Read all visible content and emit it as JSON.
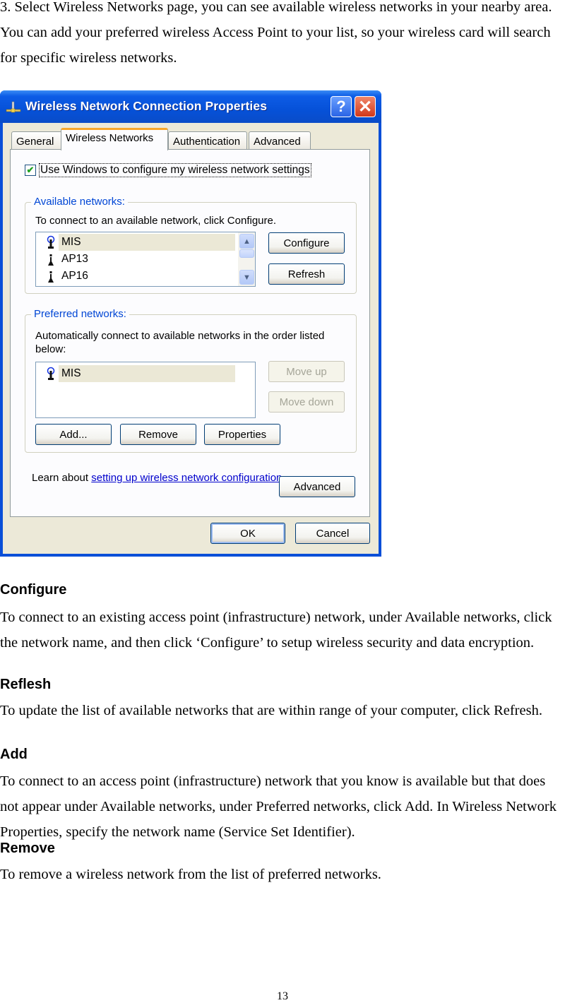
{
  "intro": "3. Select Wireless Networks page, you can see available wireless networks in your nearby area. You can add your preferred wireless Access Point to your list, so your wireless card will search for specific wireless networks.",
  "dialog": {
    "title": "Wireless Network Connection Properties",
    "help_label": "?",
    "close_label": "✕",
    "tabs": [
      {
        "label": "General"
      },
      {
        "label": "Wireless Networks",
        "active": true
      },
      {
        "label": "Authentication"
      },
      {
        "label": "Advanced"
      }
    ],
    "use_windows_checkbox": {
      "label": "Use Windows to configure my wireless network settings",
      "checked": true,
      "check_glyph": "✔"
    },
    "available": {
      "title": "Available networks:",
      "description": "To connect to an available network, click Configure.",
      "networks": [
        {
          "name": "MIS",
          "selected": true,
          "icon": "wireless-ap-configured-icon"
        },
        {
          "name": "AP13",
          "selected": false,
          "icon": "wireless-ap-icon"
        },
        {
          "name": "AP16",
          "selected": false,
          "icon": "wireless-ap-icon"
        }
      ],
      "configure_label": "Configure",
      "refresh_label": "Refresh",
      "scroll_up_glyph": "▲",
      "scroll_down_glyph": "▼"
    },
    "preferred": {
      "title": "Preferred networks:",
      "description": "Automatically connect to available networks in the order listed below:",
      "networks": [
        {
          "name": "MIS",
          "selected": true,
          "icon": "wireless-ap-configured-icon"
        }
      ],
      "move_up_label": "Move up",
      "move_down_label": "Move down",
      "add_label": "Add...",
      "remove_label": "Remove",
      "properties_label": "Properties"
    },
    "learn_prefix": "Learn about ",
    "learn_link": "setting up wireless network configuration.",
    "advanced_label": "Advanced",
    "ok_label": "OK",
    "cancel_label": "Cancel"
  },
  "sections": [
    {
      "heading": "Configure",
      "body": "To connect to an existing access point (infrastructure) network, under Available networks, click the network name, and then click ‘Configure’ to setup wireless security and data encryption."
    },
    {
      "heading": "Reflesh",
      "body": "To update the list of available networks that are within range of your computer, click Refresh."
    },
    {
      "heading": "Add",
      "body": "To connect to an access point (infrastructure) network that you know is available but that does not appear under Available networks, under Preferred networks, click Add. In Wireless Network Properties, specify the network name (Service Set Identifier)."
    },
    {
      "heading": "Remove",
      "body": "To remove a wireless network from the list of preferred networks."
    }
  ],
  "page_number": "13"
}
